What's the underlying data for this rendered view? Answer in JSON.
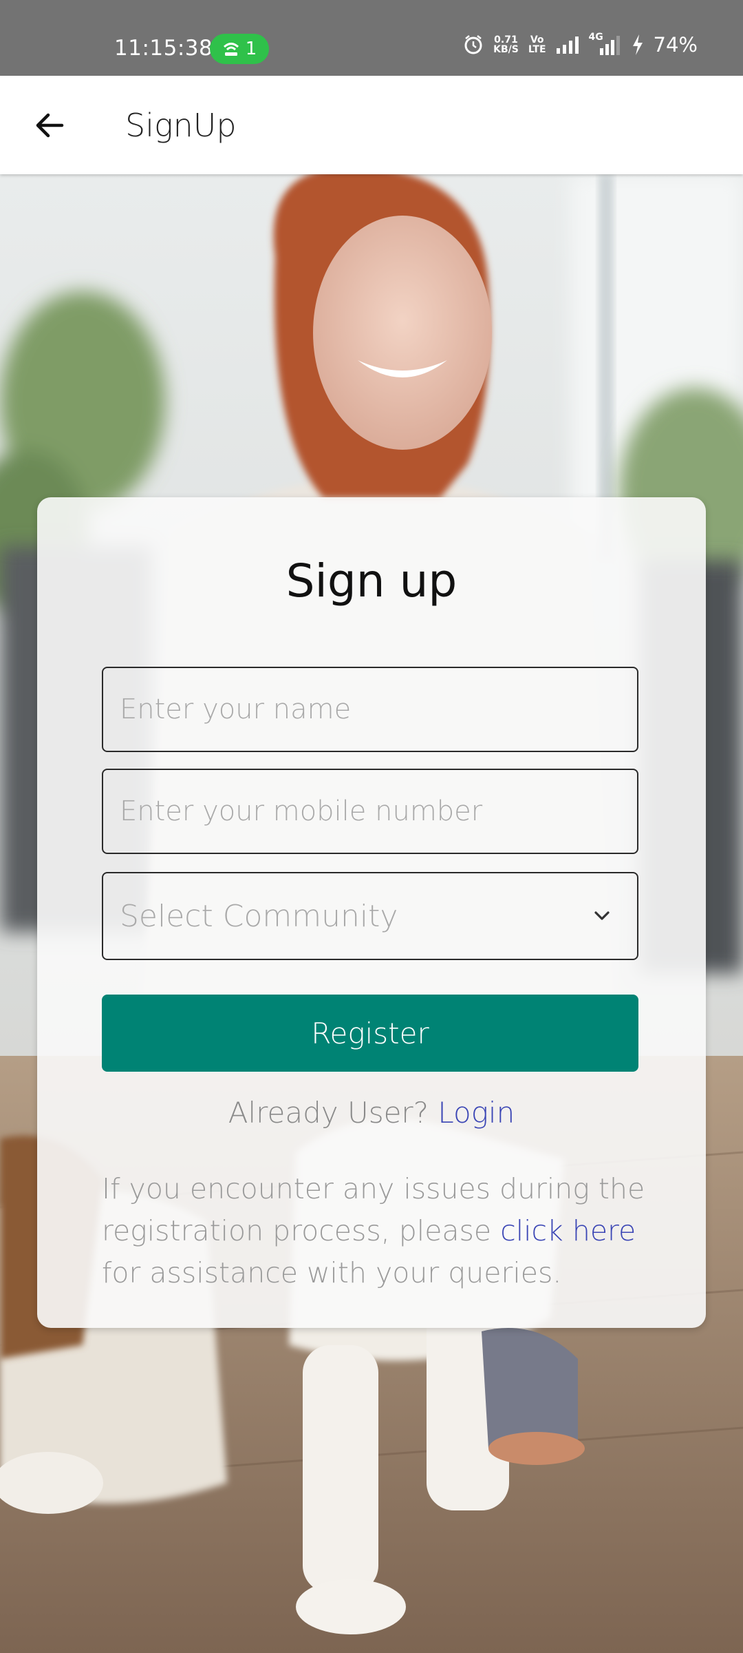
{
  "status_bar": {
    "time": "11:15:38",
    "hotspot_count": "1",
    "net_speed_value": "0.71",
    "net_speed_unit": "KB/S",
    "volte_top": "Vo",
    "volte_bottom": "LTE",
    "network_type": "4G",
    "battery_percent": "74%",
    "accent_color": "#2fc14a"
  },
  "app_bar": {
    "title": "SignUp",
    "back_icon": "arrow-left-icon"
  },
  "form": {
    "heading": "Sign up",
    "name_placeholder": "Enter your name",
    "mobile_placeholder": "Enter your mobile number",
    "community_placeholder": "Select Community",
    "register_label": "Register",
    "already_user_text": "Already User?",
    "login_link": "Login",
    "help_prefix": "If you encounter any issues during the registration process, please",
    "help_link": "click here",
    "help_suffix": "for assistance with your queries.",
    "primary_color": "#008374",
    "link_color": "#3b46b5"
  }
}
